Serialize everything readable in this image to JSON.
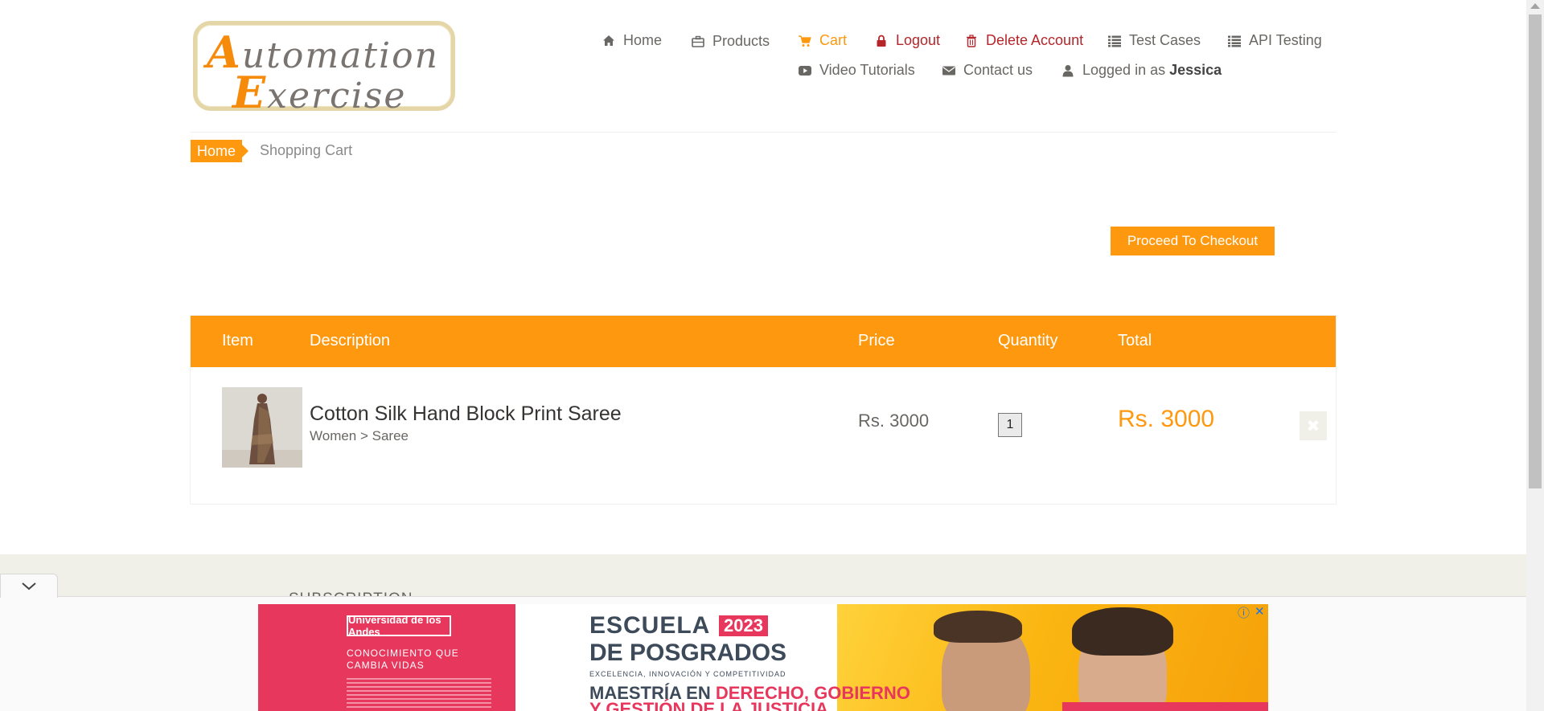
{
  "logo": {
    "line1_cap": "A",
    "line1_rest": "utomation",
    "line2_cap": "E",
    "line2_rest": "xercise"
  },
  "nav": {
    "home": "Home",
    "products": "Products",
    "cart": "Cart",
    "logout": "Logout",
    "delete_account": "Delete Account",
    "test_cases": "Test Cases",
    "api_testing": "API Testing",
    "video_tutorials": "Video Tutorials",
    "contact_us": "Contact us",
    "logged_in_prefix": "Logged in as",
    "logged_in_user": "Jessica"
  },
  "breadcrumb": {
    "home": "Home",
    "current": "Shopping Cart"
  },
  "checkout_button": "Proceed To Checkout",
  "cart": {
    "headers": {
      "item": "Item",
      "description": "Description",
      "price": "Price",
      "quantity": "Quantity",
      "total": "Total"
    },
    "rows": [
      {
        "name": "Cotton Silk Hand Block Print Saree",
        "category": "Women > Saree",
        "price": "Rs. 3000",
        "quantity": "1",
        "total": "Rs. 3000",
        "delete_symbol": "✖"
      }
    ]
  },
  "footer": {
    "subscription": "SUBSCRIPTION"
  },
  "ad": {
    "university": "Universidad de los Andes",
    "tagline_1": "CONOCIMIENTO QUE",
    "tagline_2": "CAMBIA VIDAS",
    "heading_1": "ESCUELA",
    "year": "2023",
    "heading_2": "DE POSGRADOS",
    "heading_3": "EXCELENCIA, INNOVACIÓN Y COMPETITIVIDAD",
    "program_prefix": "MAESTRÍA EN",
    "program_highlight": "DERECHO, GOBIERNO",
    "program_line_2": "Y GESTIÓN DE LA JUSTICIA",
    "info_symbol": "ⓘ",
    "close_symbol": "✕"
  },
  "colors": {
    "accent": "#fe980f",
    "danger": "#b5252a",
    "ad_pink": "#e8375d",
    "ad_yellow": "#fbb612"
  }
}
